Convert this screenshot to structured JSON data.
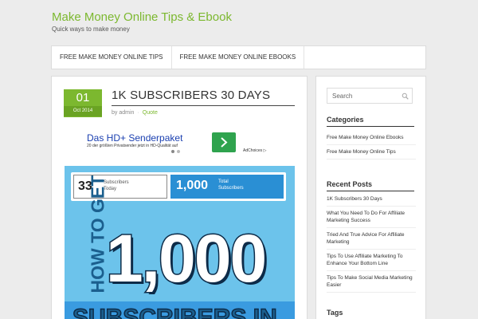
{
  "site": {
    "title": "Make Money Online Tips & Ebook",
    "description": "Quick ways to make money"
  },
  "nav": {
    "items": [
      {
        "label": "FREE MAKE MONEY ONLINE TIPS"
      },
      {
        "label": "FREE MAKE MONEY ONLINE EBOOKS"
      }
    ]
  },
  "post": {
    "date_day": "01",
    "date_month": "Oct 2014",
    "title": "1K SUBSCRIBERS 30 DAYS",
    "meta_prefix": "by",
    "author": "admin",
    "category": "Quote"
  },
  "ad": {
    "title": "Das HD+ Senderpaket",
    "text": "20 der größten Privatsender jetzt in HD-Qualität auf",
    "choices": "AdChoices ▷"
  },
  "featured": {
    "left_number": "33",
    "left_label": "Subscribers\nToday",
    "right_number": "1,000",
    "right_label": "Total\nSubscribers",
    "howto": "HOW TO GET",
    "big_number": "1,000",
    "bottom_text": "SUBSCRIBERS IN"
  },
  "sidebar": {
    "search_placeholder": "Search",
    "categories_title": "Categories",
    "categories": [
      {
        "label": "Free Make Money Online Ebooks"
      },
      {
        "label": "Free Make Money Online Tips"
      }
    ],
    "recent_title": "Recent Posts",
    "recent_posts": [
      {
        "label": "1K Subscribers 30 Days"
      },
      {
        "label": "What You Need To Do For Affiliate Marketing Success"
      },
      {
        "label": "Tried And True Advice For Affiliate Marketing"
      },
      {
        "label": "Tips To Use Affiliate Marketing To Enhance Your Bottom Line"
      },
      {
        "label": "Tips To Make Social Media Marketing Easier"
      }
    ],
    "tags_title": "Tags"
  },
  "colors": {
    "accent": "#7cb82f",
    "background": "#ececec",
    "featured_bg": "#6cc3eb"
  }
}
